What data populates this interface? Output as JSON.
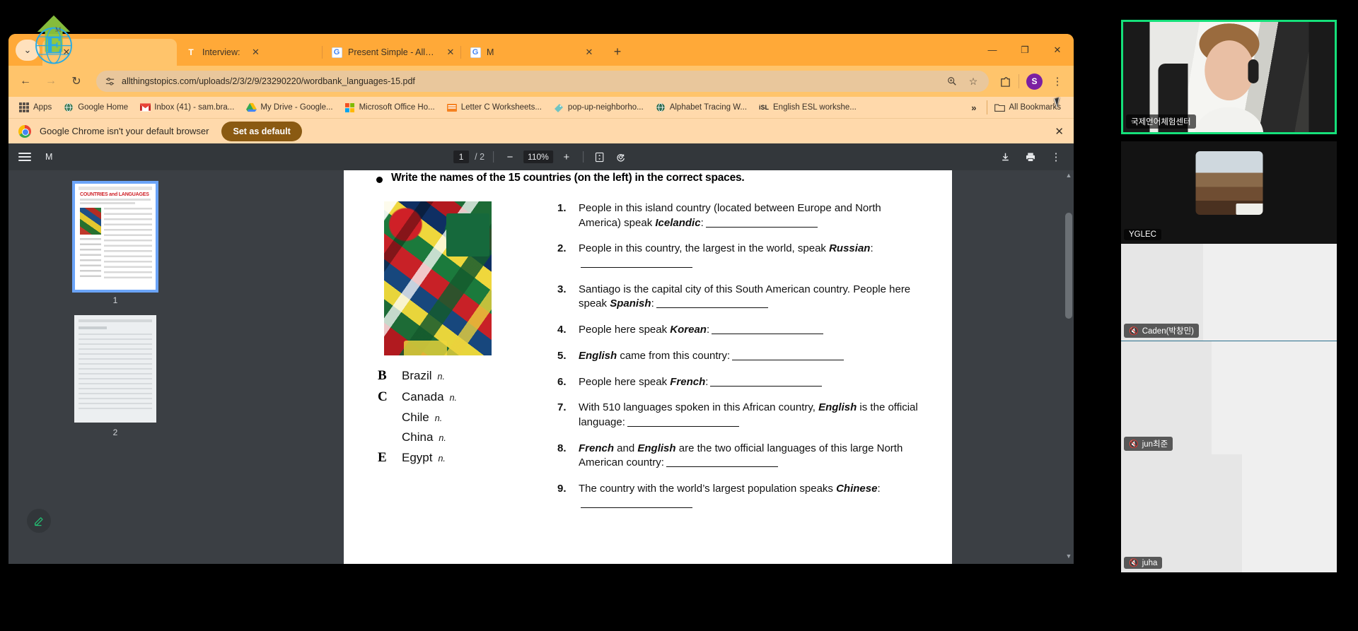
{
  "browser": {
    "tabs": [
      {
        "title": "",
        "favicon": "",
        "active": true,
        "has_close": true
      },
      {
        "title": "Interview:",
        "favicon": "T",
        "active": false,
        "has_close": true
      },
      {
        "title": "Present Simple - All Things Gra",
        "favicon": "G",
        "active": false,
        "has_close": true
      },
      {
        "title": "M",
        "favicon": "G",
        "active": false,
        "has_close": true
      }
    ],
    "new_tab_label": "+",
    "window_controls": {
      "minimize": "—",
      "maximize": "❐",
      "close": "✕"
    },
    "tabstrip_menu": "⌄",
    "nav": {
      "back": "←",
      "forward": "→",
      "reload": "↻"
    },
    "omnibox": {
      "url": "allthingstopics.com/uploads/2/3/2/9/23290220/wordbank_languages-15.pdf",
      "site_icon": "tune-icon",
      "zoom_icon": "⊕",
      "bookmark_icon": "☆"
    },
    "toolbar_right": {
      "extensions_icon": "extensions-icon",
      "profile_initial": "S",
      "menu_icon": "⋮"
    },
    "bookmarks": [
      {
        "label": "Apps",
        "icon": "apps-grid"
      },
      {
        "label": "Google Home",
        "icon": "globe"
      },
      {
        "label": "Inbox (41) - sam.bra...",
        "icon": "gmail"
      },
      {
        "label": "My Drive - Google...",
        "icon": "drive"
      },
      {
        "label": "Microsoft Office Ho...",
        "icon": "microsoft"
      },
      {
        "label": "Letter C Worksheets...",
        "icon": "orange-doc"
      },
      {
        "label": "pop-up-neighborho...",
        "icon": "teal-tag"
      },
      {
        "label": "Alphabet Tracing W...",
        "icon": "globe-dark"
      },
      {
        "label": "English ESL workshe...",
        "icon": "isl"
      }
    ],
    "bookmarks_overflow": "»",
    "all_bookmarks_label": "All Bookmarks",
    "infobar": {
      "text": "Google Chrome isn't your default browser",
      "button": "Set as default",
      "close": "✕"
    }
  },
  "pdf": {
    "doc_title": "M",
    "page_current": "1",
    "page_total": "/ 2",
    "zoom": "110%",
    "zoom_out": "−",
    "zoom_in": "+",
    "fit_icon": "fit-page-icon",
    "rotate_icon": "rotate-icon",
    "download_icon": "download-icon",
    "print_icon": "print-icon",
    "more_icon": "⋮",
    "menu_icon": "sidebar-toggle-icon",
    "thumbnails": [
      {
        "label": "1",
        "selected": true
      },
      {
        "label": "2",
        "selected": false
      }
    ],
    "edit_fab_icon": "pencil-icon"
  },
  "worksheet": {
    "heading": "Write the names of the 15 countries (on the left) in the correct spaces.",
    "flag_image_alt": "pile-of-world-flags",
    "countries": [
      {
        "letter": "B",
        "name": "Brazil",
        "pos": "n."
      },
      {
        "letter": "C",
        "name": "Canada",
        "pos": "n."
      },
      {
        "letter": "",
        "name": "Chile",
        "pos": "n."
      },
      {
        "letter": "",
        "name": "China",
        "pos": "n."
      },
      {
        "letter": "E",
        "name": "Egypt",
        "pos": "n."
      }
    ],
    "questions": [
      {
        "num": "1.",
        "parts": [
          {
            "t": "People in this island country (located between Europe and North America) speak ",
            "b": false
          },
          {
            "t": "Icelandic",
            "b": true
          },
          {
            "t": ":",
            "b": false
          },
          {
            "t": "__BLANK__",
            "b": false
          }
        ]
      },
      {
        "num": "2.",
        "parts": [
          {
            "t": "People in this country, the  largest in the world, speak ",
            "b": false
          },
          {
            "t": "Russian",
            "b": true
          },
          {
            "t": ":",
            "b": false
          },
          {
            "t": "__BLANK__",
            "b": false
          }
        ]
      },
      {
        "num": "3.",
        "parts": [
          {
            "t": "Santiago is the capital city of this South American country.  People here speak ",
            "b": false
          },
          {
            "t": "Spanish",
            "b": true
          },
          {
            "t": ":",
            "b": false
          },
          {
            "t": "__BLANK__",
            "b": false
          }
        ]
      },
      {
        "num": "4.",
        "parts": [
          {
            "t": "People here speak ",
            "b": false
          },
          {
            "t": "Korean",
            "b": true
          },
          {
            "t": ":",
            "b": false
          },
          {
            "t": "__BLANK__",
            "b": false
          }
        ]
      },
      {
        "num": "5.",
        "parts": [
          {
            "t": "English",
            "b": true
          },
          {
            "t": " came from this country:",
            "b": false
          },
          {
            "t": "__BLANK__",
            "b": false
          }
        ]
      },
      {
        "num": "6.",
        "parts": [
          {
            "t": "People here speak ",
            "b": false
          },
          {
            "t": "French",
            "b": true
          },
          {
            "t": ":",
            "b": false
          },
          {
            "t": "__BLANK__",
            "b": false
          }
        ]
      },
      {
        "num": "7.",
        "parts": [
          {
            "t": "With  510 languages spoken in this  African country,  ",
            "b": false
          },
          {
            "t": "English",
            "b": true
          },
          {
            "t": " is the official language:",
            "b": false
          },
          {
            "t": "__BLANK__",
            "b": false
          }
        ]
      },
      {
        "num": "8.",
        "parts": [
          {
            "t": "French",
            "b": true
          },
          {
            "t": " and ",
            "b": false
          },
          {
            "t": "English",
            "b": true
          },
          {
            "t": " are the two official languages of this large North American country:",
            "b": false
          },
          {
            "t": "__BLANK__",
            "b": false
          }
        ]
      },
      {
        "num": "9.",
        "parts": [
          {
            "t": "The country with the world’s largest population speaks ",
            "b": false
          },
          {
            "t": "Chinese",
            "b": true
          },
          {
            "t": ":",
            "b": false
          },
          {
            "t": "__BLANK__",
            "b": false
          }
        ]
      }
    ]
  },
  "video_panel": {
    "participants": [
      {
        "name": "국제언어체험센터",
        "muted": false,
        "speaking": true
      },
      {
        "name": "YGLEC",
        "muted": false,
        "speaking": false
      },
      {
        "name": "Caden(박창민)",
        "muted": true,
        "speaking": false
      },
      {
        "name": "jun최준",
        "muted": true,
        "speaking": false
      },
      {
        "name": "juha",
        "muted": true,
        "speaking": false
      }
    ],
    "mute_glyph": "🎙",
    "accent_color": "#15e07a"
  }
}
